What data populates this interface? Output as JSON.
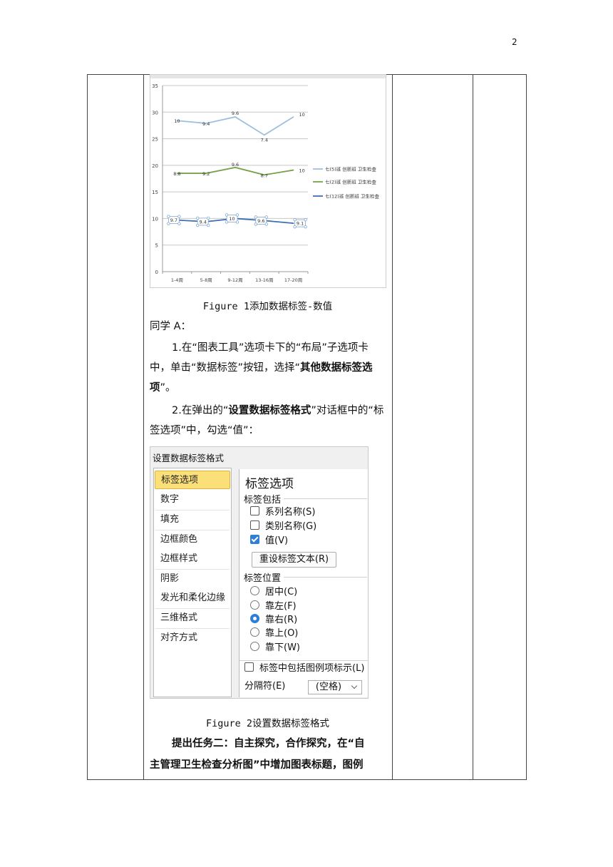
{
  "page_number": "2",
  "figure1": {
    "caption": "Figure 1添加数据标签-数值"
  },
  "chart_data": {
    "type": "line",
    "categories": [
      "1-4周",
      "5-8周",
      "9-12周",
      "13-16周",
      "17-20周"
    ],
    "ylim": [
      0,
      35
    ],
    "yticks": [
      "0",
      "5",
      "10",
      "15",
      "20",
      "25",
      "30",
      "35"
    ],
    "grid": true,
    "legend_position": "right",
    "series": [
      {
        "name": "七(5)班 创新班 卫生检查",
        "color": "#9dbfdf",
        "values": [
          28.4,
          27.9,
          29.1,
          25.7,
          29.1
        ],
        "labels": [
          "10",
          "9.4",
          "9.6",
          "7.4",
          "10"
        ]
      },
      {
        "name": "七(2)班 创新班 卫生检查",
        "color": "#77a24a",
        "values": [
          18.5,
          18.5,
          19.6,
          18.2,
          19.1
        ],
        "labels": [
          "8.8",
          "9.2",
          "9.6",
          "8.7",
          "10"
        ]
      },
      {
        "name": "七(12)班 创新班 卫生检查",
        "color": "#3d6fb6",
        "values": [
          9.7,
          9.4,
          10,
          9.6,
          9.1
        ],
        "labels": [
          "9.7",
          "9.4",
          "10",
          "9.6",
          "9.1"
        ]
      }
    ]
  },
  "text": {
    "student": "同学 A：",
    "step1_a": "1.在“图表工具”选项卡下的“布局”子选项卡中，单击“数据标签”按钮，选择“",
    "step1_b": "其他数据标签选项",
    "step1_c": "”。",
    "step2_a": "2.在弹出的“",
    "step2_b": "设置数据标签格式",
    "step2_c": "”对话框中的“标签选项”中，勾选“值”："
  },
  "dialog": {
    "title": "设置数据标签格式",
    "nav": [
      "标签选项",
      "数字",
      "填充",
      "边框颜色",
      "边框样式",
      "阴影",
      "发光和柔化边缘",
      "三维格式",
      "对齐方式"
    ],
    "heading": "标签选项",
    "section_include": "标签包括",
    "opt_series": "系列名称(S)",
    "opt_category": "类别名称(G)",
    "opt_value": "值(V)",
    "reset_button": "重设标签文本(R)",
    "section_position": "标签位置",
    "pos_center": "居中(C)",
    "pos_left": "靠左(F)",
    "pos_right": "靠右(R)",
    "pos_top": "靠上(O)",
    "pos_bottom": "靠下(W)",
    "opt_legend_key": "标签中包括图例项标示(L)",
    "separator_label": "分隔符(E)",
    "separator_value": "(空格)"
  },
  "figure2": {
    "caption": "Figure 2设置数据标签格式"
  },
  "task2": {
    "line1": "提出任务二：自主探究，合作探究，在“自",
    "line2": "主管理卫生检查分析图”中增加图表标题，图例"
  }
}
